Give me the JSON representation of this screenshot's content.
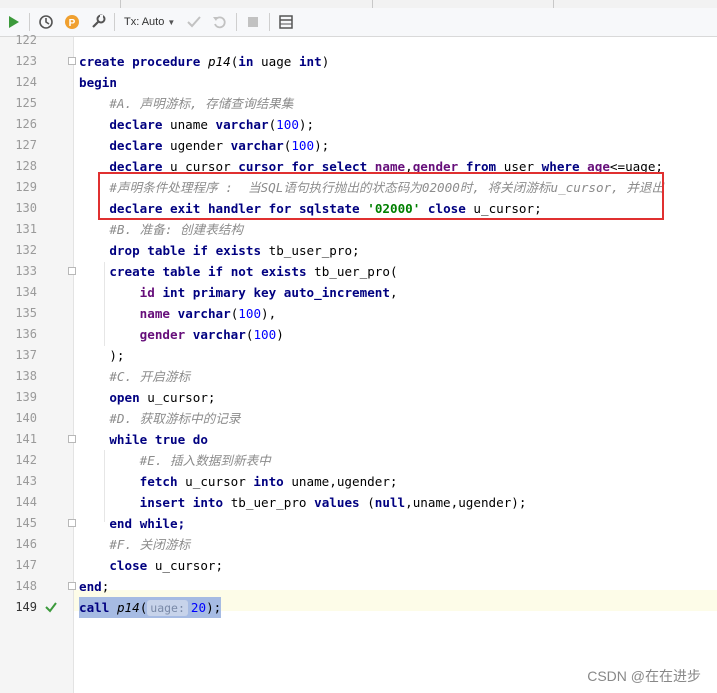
{
  "toolbar": {
    "tx_mode": "Tx: Auto",
    "p_badge": "P",
    "icons": [
      "run-icon",
      "history-icon",
      "profile-icon",
      "settings-icon",
      "commit-icon",
      "rollback-icon",
      "stop-icon",
      "output-icon"
    ]
  },
  "editor": {
    "lines": [
      {
        "num": "122"
      },
      {
        "num": "123"
      },
      {
        "num": "124"
      },
      {
        "num": "125"
      },
      {
        "num": "126"
      },
      {
        "num": "127"
      },
      {
        "num": "128"
      },
      {
        "num": "129"
      },
      {
        "num": "130"
      },
      {
        "num": "131"
      },
      {
        "num": "132"
      },
      {
        "num": "133"
      },
      {
        "num": "134"
      },
      {
        "num": "135"
      },
      {
        "num": "136"
      },
      {
        "num": "137"
      },
      {
        "num": "138"
      },
      {
        "num": "139"
      },
      {
        "num": "140"
      },
      {
        "num": "141"
      },
      {
        "num": "142"
      },
      {
        "num": "143"
      },
      {
        "num": "144"
      },
      {
        "num": "145"
      },
      {
        "num": "146"
      },
      {
        "num": "147"
      },
      {
        "num": "148"
      },
      {
        "num": "149"
      }
    ],
    "tokens": {
      "create": "create",
      "procedure": "procedure",
      "p14": "p14",
      "open_paren": "(",
      "in": "in",
      "uage": " uage ",
      "int": "int",
      "close_paren_1": ")",
      "begin": "begin",
      "c125": "#A. 声明游标, 存储查询结果集",
      "declare": "declare",
      "uname": " uname ",
      "varchar": "varchar",
      "n100": "100",
      "semi_paren": ");",
      "ugender": " ugender ",
      "ucursor": " u_cursor ",
      "cursor": "cursor",
      "for": "for",
      "select": "select",
      "name": "name",
      "comma": ",",
      "gender": "gender",
      "from": "from",
      "user": " user ",
      "where": "where",
      "age": "age",
      "cond": "<=uage;",
      "c129": "#声明条件处理程序 :  当SQL语句执行抛出的状态码为02000时, 将关闭游标u_cursor, 并退出",
      "exit": "exit",
      "handler": "handler",
      "sqlstate": "sqlstate",
      "s02000": "'02000'",
      "close": "close",
      "ucursor_end": " u_cursor;",
      "c131": "#B. 准备: 创建表结构",
      "drop": "drop",
      "table": "table",
      "if": "if",
      "exists": "exists",
      "tb_user_pro": " tb_user_pro;",
      "create2": "create",
      "not": "not",
      "tb_uer_pro_open": " tb_uer_pro(",
      "id": "id",
      "primary": "primary",
      "key": "key",
      "auto_increment": "auto_increment",
      "comma_end": ",",
      "paren_comma": "),",
      "paren_only": ")",
      "close_semi": ");",
      "c138": "#C. 开启游标",
      "open": "open",
      "ucursor_semi": " u_cursor;",
      "c140": "#D. 获取游标中的记录",
      "while": "while",
      "true": "true",
      "do": "do",
      "c142": "#E. 插入数据到新表中",
      "fetch": "fetch",
      "into": "into",
      "uname_ugender": " uname,ugender;",
      "insert": "insert",
      "tb_uer_pro": " tb_uer_pro ",
      "values": "values",
      "open_null": " (",
      "null": "null",
      "uname_ugender_end": ",uname,ugender);",
      "end": "end",
      "while_semi": "while;",
      "c146": "#F. 关闭游标",
      "end_semi": ";",
      "call": "call",
      "p14_call": "p14",
      "hint_uage": "uage:",
      "n20": "20",
      "call_end": ");"
    }
  },
  "watermark": "CSDN @在在进步"
}
